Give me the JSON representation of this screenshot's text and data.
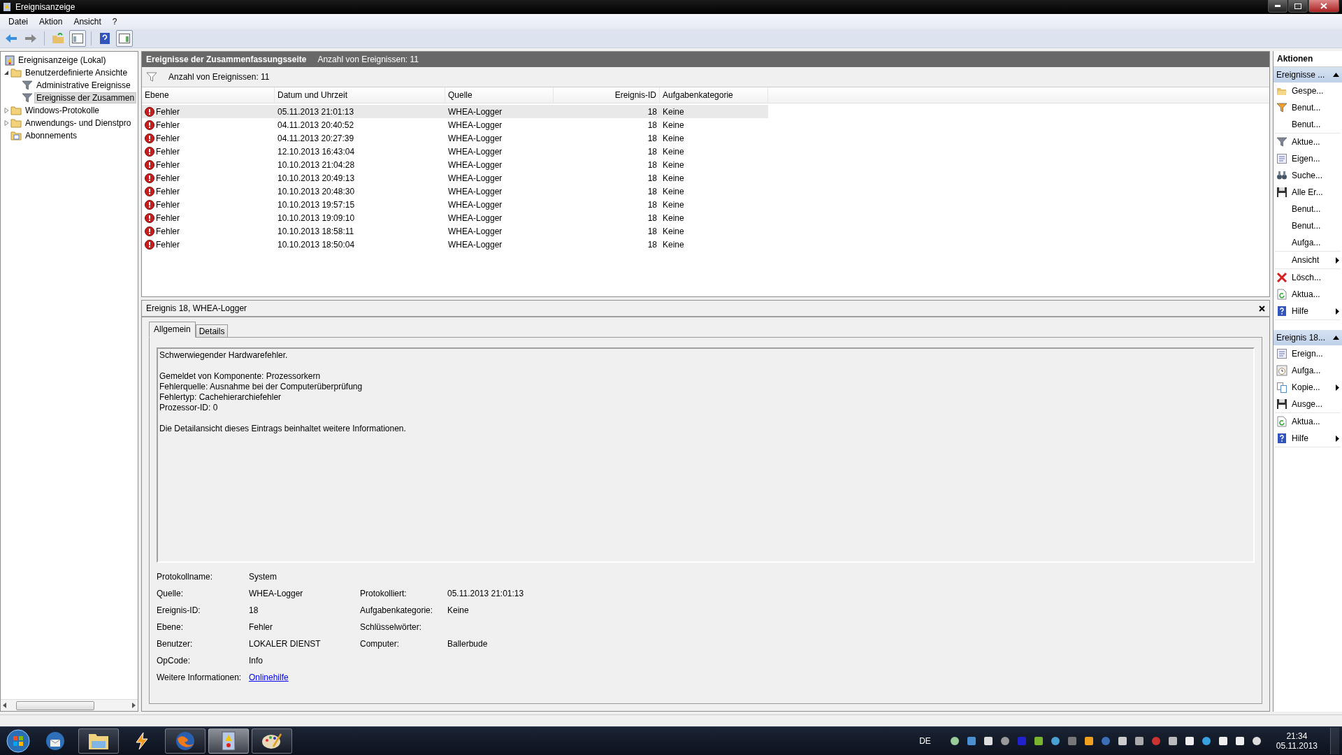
{
  "window": {
    "title": "Ereignisanzeige"
  },
  "menu": [
    "Datei",
    "Aktion",
    "Ansicht",
    "?"
  ],
  "tree": [
    {
      "label": "Ereignisanzeige (Lokal)",
      "kind": "viewer",
      "selected": false,
      "children": [
        {
          "label": "Benutzerdefinierte Ansichte",
          "kind": "folder",
          "expanded": true,
          "selected": false,
          "children": [
            {
              "label": "Administrative Ereignisse",
              "kind": "filter",
              "selected": false
            },
            {
              "label": "Ereignisse der Zusammen",
              "kind": "filter",
              "selected": true
            }
          ]
        },
        {
          "label": "Windows-Protokolle",
          "kind": "folder",
          "expanded": false,
          "selected": false
        },
        {
          "label": "Anwendungs- und Dienstpro",
          "kind": "folder",
          "expanded": false,
          "selected": false
        },
        {
          "label": "Abonnements",
          "kind": "subscription",
          "selected": false
        }
      ]
    }
  ],
  "summary": {
    "title": "Ereignisse der Zusammenfassungsseite",
    "count": "Anzahl von Ereignissen: 11"
  },
  "filter": "Anzahl von Ereignissen: 11",
  "table": {
    "columns": [
      {
        "label": "Ebene"
      },
      {
        "label": "Datum und Uhrzeit"
      },
      {
        "label": "Quelle"
      },
      {
        "label": "Ereignis-ID"
      },
      {
        "label": "Aufgabenkategorie"
      }
    ],
    "rows": [
      {
        "level": "Fehler",
        "date": "05.11.2013 21:01:13",
        "source": "WHEA-Logger",
        "id": "18",
        "category": "Keine",
        "selected": true
      },
      {
        "level": "Fehler",
        "date": "04.11.2013 20:40:52",
        "source": "WHEA-Logger",
        "id": "18",
        "category": "Keine",
        "selected": false
      },
      {
        "level": "Fehler",
        "date": "04.11.2013 20:27:39",
        "source": "WHEA-Logger",
        "id": "18",
        "category": "Keine",
        "selected": false
      },
      {
        "level": "Fehler",
        "date": "12.10.2013 16:43:04",
        "source": "WHEA-Logger",
        "id": "18",
        "category": "Keine",
        "selected": false
      },
      {
        "level": "Fehler",
        "date": "10.10.2013 21:04:28",
        "source": "WHEA-Logger",
        "id": "18",
        "category": "Keine",
        "selected": false
      },
      {
        "level": "Fehler",
        "date": "10.10.2013 20:49:13",
        "source": "WHEA-Logger",
        "id": "18",
        "category": "Keine",
        "selected": false
      },
      {
        "level": "Fehler",
        "date": "10.10.2013 20:48:30",
        "source": "WHEA-Logger",
        "id": "18",
        "category": "Keine",
        "selected": false
      },
      {
        "level": "Fehler",
        "date": "10.10.2013 19:57:15",
        "source": "WHEA-Logger",
        "id": "18",
        "category": "Keine",
        "selected": false
      },
      {
        "level": "Fehler",
        "date": "10.10.2013 19:09:10",
        "source": "WHEA-Logger",
        "id": "18",
        "category": "Keine",
        "selected": false
      },
      {
        "level": "Fehler",
        "date": "10.10.2013 18:58:11",
        "source": "WHEA-Logger",
        "id": "18",
        "category": "Keine",
        "selected": false
      },
      {
        "level": "Fehler",
        "date": "10.10.2013 18:50:04",
        "source": "WHEA-Logger",
        "id": "18",
        "category": "Keine",
        "selected": false
      }
    ]
  },
  "detail": {
    "title": "Ereignis 18, WHEA-Logger",
    "tabs": [
      {
        "label": "Allgemein",
        "selected": true
      },
      {
        "label": "Details",
        "selected": false
      }
    ],
    "message": [
      [
        "Schwerwiegender Hardwarefehler."
      ],
      [
        "Gemeldet von Komponente: Prozessorkern",
        "Fehlerquelle: Ausnahme bei der Computerüberprüfung",
        "Fehlertyp: Cachehierarchiefehler",
        "Prozessor-ID: 0"
      ],
      [
        "Die Detailansicht dieses Eintrags beinhaltet weitere Informationen."
      ]
    ],
    "properties": [
      [
        {
          "label": "Protokollname:",
          "value": "System"
        }
      ],
      [
        {
          "label": "Quelle:",
          "value": "WHEA-Logger"
        },
        {
          "label": "Protokolliert:",
          "value": "05.11.2013 21:01:13"
        }
      ],
      [
        {
          "label": "Ereignis-ID:",
          "value": "18"
        },
        {
          "label": "Aufgabenkategorie:",
          "value": "Keine"
        }
      ],
      [
        {
          "label": "Ebene:",
          "value": "Fehler"
        },
        {
          "label": "Schlüsselwörter:"
        }
      ],
      [
        {
          "label": "Benutzer:",
          "value": "LOKALER DIENST"
        },
        {
          "label": "Computer:",
          "value": "Ballerbude"
        }
      ],
      [
        {
          "label": "OpCode:",
          "value": "Info"
        }
      ],
      [
        {
          "label": "Weitere Informationen:",
          "value": "Onlinehilfe",
          "kind": "link"
        }
      ]
    ]
  },
  "actions": {
    "title": "Aktionen",
    "sections": [
      {
        "title": "Ereignisse ...",
        "expanded": true,
        "groups": [
          [
            {
              "label": "Gespe...",
              "kind": "open"
            },
            {
              "label": "Benut...",
              "kind": "filter-color"
            },
            {
              "label": "Benut...",
              "kind": "none"
            }
          ],
          [
            {
              "label": "Aktue...",
              "kind": "filter"
            },
            {
              "label": "Eigen...",
              "kind": "properties"
            },
            {
              "label": "Suche...",
              "kind": "find"
            },
            {
              "label": "Alle Er...",
              "kind": "save"
            },
            {
              "label": "Benut...",
              "kind": "none"
            },
            {
              "label": "Benut...",
              "kind": "none"
            },
            {
              "label": "Aufga...",
              "kind": "none"
            }
          ],
          [
            {
              "label": "Ansicht",
              "kind": "none",
              "submenu": true
            }
          ],
          [
            {
              "label": "Lösch...",
              "kind": "delete"
            },
            {
              "label": "Aktua...",
              "kind": "refresh"
            },
            {
              "label": "Hilfe",
              "kind": "help",
              "submenu": true
            }
          ]
        ]
      },
      {
        "title": "Ereignis 18...",
        "expanded": true,
        "groups": [
          [
            {
              "label": "Ereign...",
              "kind": "properties"
            },
            {
              "label": "Aufga...",
              "kind": "task"
            },
            {
              "label": "Kopie...",
              "kind": "copy",
              "submenu": true
            },
            {
              "label": "Ausge...",
              "kind": "save"
            }
          ],
          [
            {
              "label": "Aktua...",
              "kind": "refresh"
            },
            {
              "label": "Hilfe",
              "kind": "help",
              "submenu": true
            }
          ]
        ]
      }
    ]
  },
  "taskbar": {
    "apps": [
      {
        "kind": "mail",
        "running": false,
        "active": false
      },
      {
        "kind": "explorer",
        "running": true,
        "active": false
      },
      {
        "kind": "winamp",
        "running": false,
        "active": false
      },
      {
        "kind": "firefox",
        "running": true,
        "active": false
      },
      {
        "kind": "eventviewer",
        "running": true,
        "active": true
      },
      {
        "kind": "paint",
        "running": true,
        "active": false
      }
    ],
    "language": "DE",
    "time": "21:34",
    "date": "05.11.2013"
  }
}
